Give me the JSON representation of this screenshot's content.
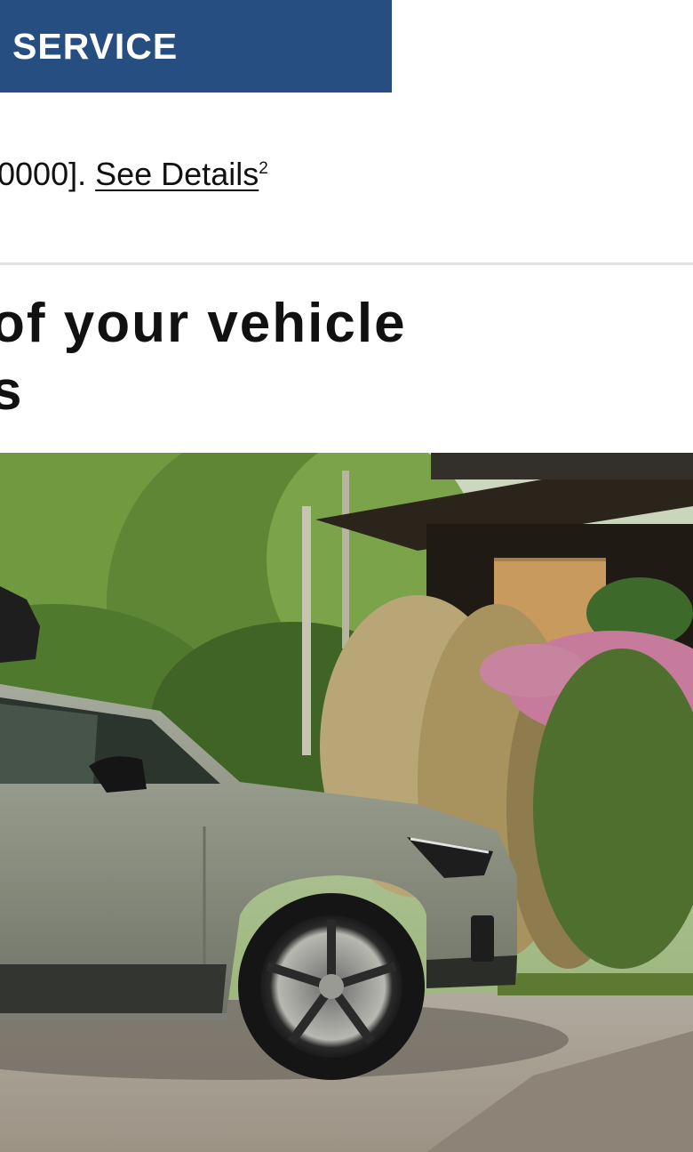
{
  "banner": {
    "label": "SERVICE"
  },
  "offer": {
    "prefix": "0000].",
    "link_label": "See Details",
    "footnote": "2"
  },
  "headline": {
    "line1": "of your vehicle",
    "line2": "s"
  },
  "hero_image": {
    "subject": "light green compact SUV parked on gravel driveway beside house with ornamental grasses and pink flowers",
    "colors": {
      "car_body": "#8e9384",
      "foliage": "#5e8a3a",
      "house": "#1e1b16",
      "door": "#c89a5e",
      "flowers": "#c77b9c",
      "gravel": "#a9a196"
    }
  },
  "colors": {
    "banner_bg": "#264e80",
    "banner_text": "#ffffff",
    "divider": "#e2e2e2"
  }
}
